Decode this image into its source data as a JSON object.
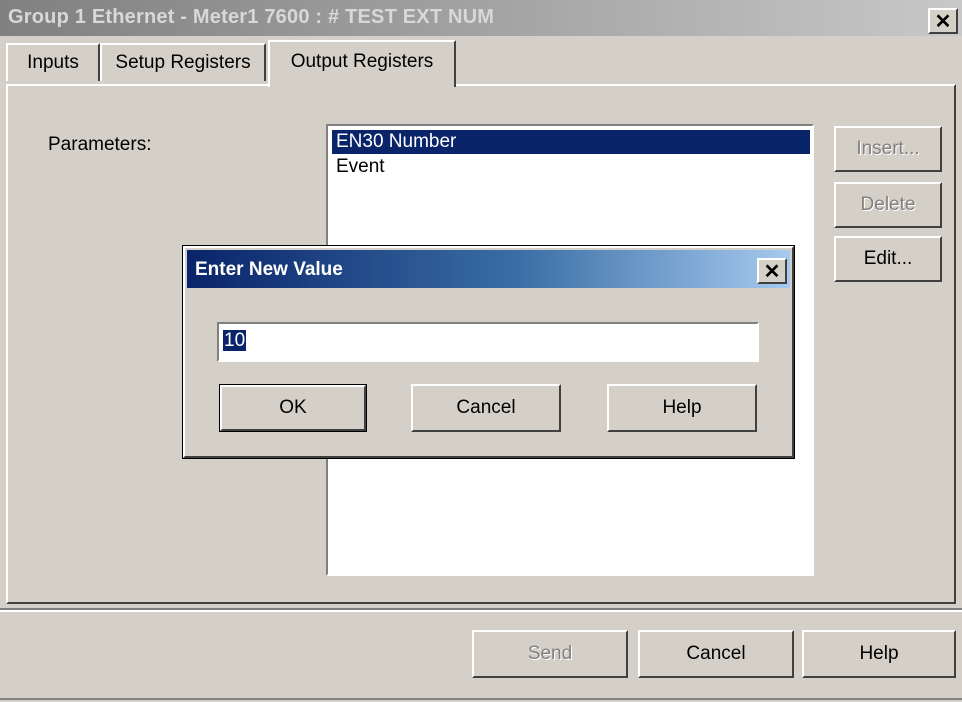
{
  "window": {
    "title": "Group 1 Ethernet - Meter1 7600 : # TEST EXT NUM",
    "close_glyph": "✕"
  },
  "tabs": [
    {
      "label": "Inputs",
      "selected": false
    },
    {
      "label": "Setup Registers",
      "selected": false
    },
    {
      "label": "Output Registers",
      "selected": true
    }
  ],
  "parameters": {
    "label": "Parameters:",
    "items": [
      "EN30 Number",
      "Event"
    ],
    "selected_index": 0
  },
  "side_buttons": {
    "insert": "Insert...",
    "delete": "Delete",
    "edit": "Edit..."
  },
  "footer": {
    "send": "Send",
    "cancel": "Cancel",
    "help": "Help"
  },
  "dialog": {
    "title": "Enter New Value",
    "close_glyph": "✕",
    "value": "10",
    "ok": "OK",
    "cancel": "Cancel",
    "help": "Help"
  },
  "colors": {
    "face": "#d4d0c8",
    "selection": "#0a246a",
    "active_title_start": "#0a246a",
    "active_title_end": "#a6caf0",
    "inactive_title": "#808080"
  }
}
